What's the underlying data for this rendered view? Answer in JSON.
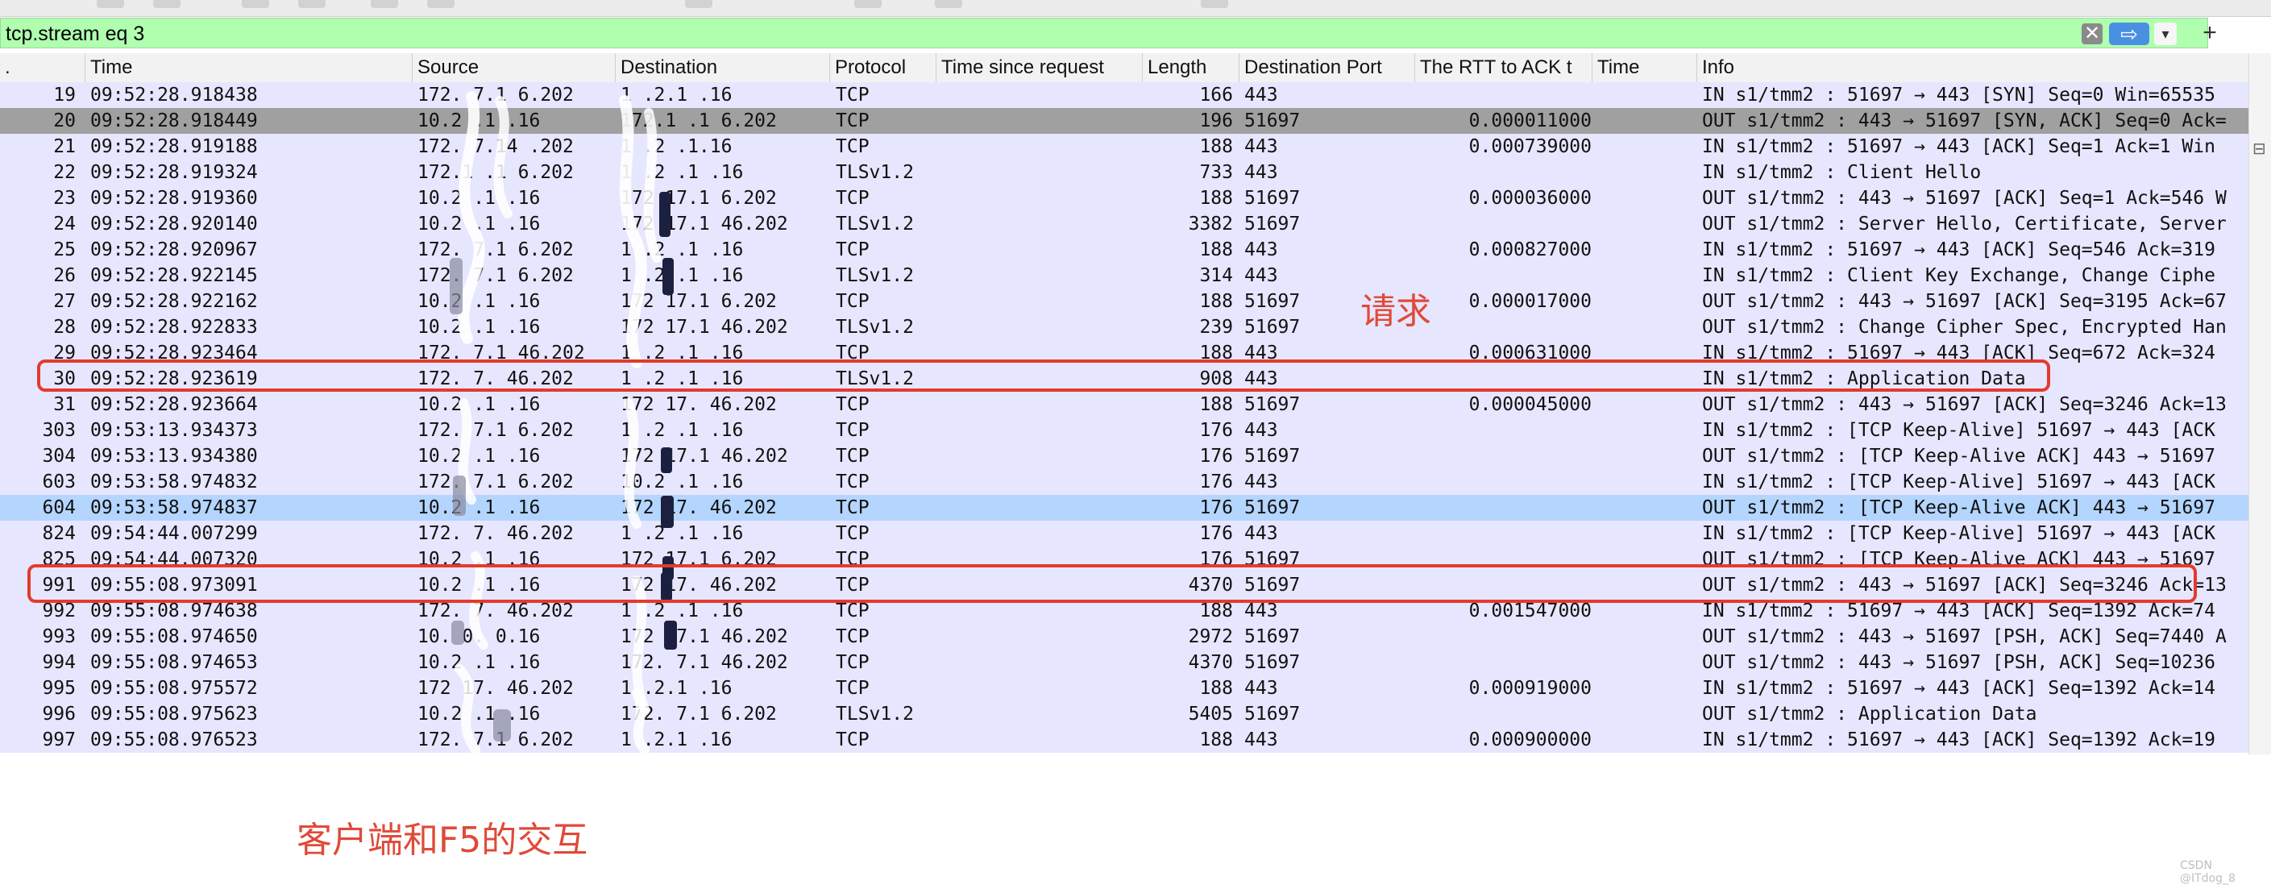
{
  "filter": {
    "expression": "tcp.stream eq 3",
    "clear_icon": "close-icon",
    "apply_icon": "arrow-right-icon",
    "dropdown_icon": "chevron-down-icon",
    "add_label": "+"
  },
  "columns": {
    "no": ".",
    "time": "Time",
    "source": "Source",
    "destination": "Destination",
    "protocol": "Protocol",
    "time_since_request": "Time since request",
    "length": "Length",
    "dest_port": "Destination Port",
    "rtt": "The RTT to ACK t",
    "time2": "Time",
    "info": "Info"
  },
  "packets": [
    {
      "no": "19",
      "time": "09:52:28.918438",
      "src": "172. 7.1 6.202",
      "dst": "1 .2.1 .16",
      "proto": "TCP",
      "len": "166",
      "dport": "443",
      "rtt": "",
      "info": "IN  s1/tmm2 : 51697 → 443 [SYN] Seq=0 Win=65535",
      "style": "tcp"
    },
    {
      "no": "20",
      "time": "09:52:28.918449",
      "src": "10.2 .1 .16",
      "dst": "172.1 .1 6.202",
      "proto": "TCP",
      "len": "196",
      "dport": "51697",
      "rtt": "0.000011000",
      "info": "OUT s1/tmm2 : 443 → 51697 [SYN, ACK] Seq=0 Ack=",
      "style": "dark"
    },
    {
      "no": "21",
      "time": "09:52:28.919188",
      "src": "172. 7.14 .202",
      "dst": "1 .2 .1.16",
      "proto": "TCP",
      "len": "188",
      "dport": "443",
      "rtt": "0.000739000",
      "info": "IN  s1/tmm2 : 51697 → 443 [ACK] Seq=1 Ack=1 Win",
      "style": "tcp"
    },
    {
      "no": "22",
      "time": "09:52:28.919324",
      "src": "172.1 .1 6.202",
      "dst": "1 .2 .1 .16",
      "proto": "TLSv1.2",
      "len": "733",
      "dport": "443",
      "rtt": "",
      "info": "IN  s1/tmm2 : Client Hello",
      "style": "tcp"
    },
    {
      "no": "23",
      "time": "09:52:28.919360",
      "src": "10.2 .1 .16",
      "dst": "172 17.1 6.202",
      "proto": "TCP",
      "len": "188",
      "dport": "51697",
      "rtt": "0.000036000",
      "info": "OUT s1/tmm2 : 443 → 51697 [ACK] Seq=1 Ack=546 W",
      "style": "tcp"
    },
    {
      "no": "24",
      "time": "09:52:28.920140",
      "src": "10.2 .1 .16",
      "dst": "172 17.1 46.202",
      "proto": "TLSv1.2",
      "len": "3382",
      "dport": "51697",
      "rtt": "",
      "info": "OUT s1/tmm2 : Server Hello, Certificate, Server",
      "style": "tcp"
    },
    {
      "no": "25",
      "time": "09:52:28.920967",
      "src": "172. 7.1 6.202",
      "dst": "1 .2 .1 .16",
      "proto": "TCP",
      "len": "188",
      "dport": "443",
      "rtt": "0.000827000",
      "info": "IN  s1/tmm2 : 51697 → 443 [ACK] Seq=546 Ack=319",
      "style": "tcp"
    },
    {
      "no": "26",
      "time": "09:52:28.922145",
      "src": "172. 7.1 6.202",
      "dst": "1 .2 .1 .16",
      "proto": "TLSv1.2",
      "len": "314",
      "dport": "443",
      "rtt": "",
      "info": "IN  s1/tmm2 : Client Key Exchange, Change Ciphe",
      "style": "tcp"
    },
    {
      "no": "27",
      "time": "09:52:28.922162",
      "src": "10.2 .1 .16",
      "dst": "172 17.1 6.202",
      "proto": "TCP",
      "len": "188",
      "dport": "51697",
      "rtt": "0.000017000",
      "info": "OUT s1/tmm2 : 443 → 51697 [ACK] Seq=3195 Ack=67",
      "style": "tcp"
    },
    {
      "no": "28",
      "time": "09:52:28.922833",
      "src": "10.2 .1 .16",
      "dst": "172 17.1 46.202",
      "proto": "TLSv1.2",
      "len": "239",
      "dport": "51697",
      "rtt": "",
      "info": "OUT s1/tmm2 : Change Cipher Spec, Encrypted Han",
      "style": "tcp"
    },
    {
      "no": "29",
      "time": "09:52:28.923464",
      "src": "172. 7.1 46.202",
      "dst": "1 .2 .1 .16",
      "proto": "TCP",
      "len": "188",
      "dport": "443",
      "rtt": "0.000631000",
      "info": "IN  s1/tmm2 : 51697 → 443 [ACK] Seq=672 Ack=324",
      "style": "tcp"
    },
    {
      "no": "30",
      "time": "09:52:28.923619",
      "src": "172. 7. 46.202",
      "dst": "1 .2 .1 .16",
      "proto": "TLSv1.2",
      "len": "908",
      "dport": "443",
      "rtt": "",
      "info": "IN  s1/tmm2 : Application Data",
      "style": "tcp"
    },
    {
      "no": "31",
      "time": "09:52:28.923664",
      "src": "10.2 .1 .16",
      "dst": "172 17. 46.202",
      "proto": "TCP",
      "len": "188",
      "dport": "51697",
      "rtt": "0.000045000",
      "info": "OUT s1/tmm2 : 443 → 51697 [ACK] Seq=3246 Ack=13",
      "style": "tcp"
    },
    {
      "no": "303",
      "time": "09:53:13.934373",
      "src": "172. 7.1 6.202",
      "dst": "1 .2 .1 .16",
      "proto": "TCP",
      "len": "176",
      "dport": "443",
      "rtt": "",
      "info": "IN  s1/tmm2 : [TCP Keep-Alive] 51697 → 443 [ACK",
      "style": "tcp"
    },
    {
      "no": "304",
      "time": "09:53:13.934380",
      "src": "10.2 .1 .16",
      "dst": "172 17.1 46.202",
      "proto": "TCP",
      "len": "176",
      "dport": "51697",
      "rtt": "",
      "info": "OUT s1/tmm2 : [TCP Keep-Alive ACK] 443 → 51697",
      "style": "tcp"
    },
    {
      "no": "603",
      "time": "09:53:58.974832",
      "src": "172. 7.1 6.202",
      "dst": "10.2 .1 .16",
      "proto": "TCP",
      "len": "176",
      "dport": "443",
      "rtt": "",
      "info": "IN  s1/tmm2 : [TCP Keep-Alive] 51697 → 443 [ACK",
      "style": "tcp"
    },
    {
      "no": "604",
      "time": "09:53:58.974837",
      "src": "10.2 .1 .16",
      "dst": "172 17. 46.202",
      "proto": "TCP",
      "len": "176",
      "dport": "51697",
      "rtt": "",
      "info": "OUT s1/tmm2 : [TCP Keep-Alive ACK] 443 → 51697",
      "style": "sel"
    },
    {
      "no": "824",
      "time": "09:54:44.007299",
      "src": "172. 7. 46.202",
      "dst": "1 .2 .1 .16",
      "proto": "TCP",
      "len": "176",
      "dport": "443",
      "rtt": "",
      "info": "IN  s1/tmm2 : [TCP Keep-Alive] 51697 → 443 [ACK",
      "style": "tcp"
    },
    {
      "no": "825",
      "time": "09:54:44.007320",
      "src": "10.2 .1 .16",
      "dst": "172 17.1 6.202",
      "proto": "TCP",
      "len": "176",
      "dport": "51697",
      "rtt": "",
      "info": "OUT s1/tmm2 : [TCP Keep-Alive ACK] 443 → 51697",
      "style": "tcp"
    },
    {
      "no": "991",
      "time": "09:55:08.973091",
      "src": "10.2 .1 .16",
      "dst": "172 17. 46.202",
      "proto": "TCP",
      "len": "4370",
      "dport": "51697",
      "rtt": "",
      "info": "OUT s1/tmm2 : 443 → 51697 [ACK] Seq=3246 Ack=13",
      "style": "tcp"
    },
    {
      "no": "992",
      "time": "09:55:08.974638",
      "src": "172. 7. 46.202",
      "dst": "1 .2 .1 .16",
      "proto": "TCP",
      "len": "188",
      "dport": "443",
      "rtt": "0.001547000",
      "info": "IN  s1/tmm2 : 51697 → 443 [ACK] Seq=1392 Ack=74",
      "style": "tcp"
    },
    {
      "no": "993",
      "time": "09:55:08.974650",
      "src": "10. 0. 0.16",
      "dst": "172 17.1 46.202",
      "proto": "TCP",
      "len": "2972",
      "dport": "51697",
      "rtt": "",
      "info": "OUT s1/tmm2 : 443 → 51697 [PSH, ACK] Seq=7440 A",
      "style": "tcp"
    },
    {
      "no": "994",
      "time": "09:55:08.974653",
      "src": "10.2 .1 .16",
      "dst": "172. 7.1 46.202",
      "proto": "TCP",
      "len": "4370",
      "dport": "51697",
      "rtt": "",
      "info": "OUT s1/tmm2 : 443 → 51697 [PSH, ACK] Seq=10236",
      "style": "tcp"
    },
    {
      "no": "995",
      "time": "09:55:08.975572",
      "src": "172 17. 46.202",
      "dst": "1 .2.1 .16",
      "proto": "TCP",
      "len": "188",
      "dport": "443",
      "rtt": "0.000919000",
      "info": "IN  s1/tmm2 : 51697 → 443 [ACK] Seq=1392 Ack=14",
      "style": "tcp"
    },
    {
      "no": "996",
      "time": "09:55:08.975623",
      "src": "10.2 .1 .16",
      "dst": "172. 7.1 6.202",
      "proto": "TLSv1.2",
      "len": "5405",
      "dport": "51697",
      "rtt": "",
      "info": "OUT s1/tmm2 : Application Data",
      "style": "tcp"
    },
    {
      "no": "997",
      "time": "09:55:08.976523",
      "src": "172. 7.1 6.202",
      "dst": "1 .2.1 .16",
      "proto": "TCP",
      "len": "188",
      "dport": "443",
      "rtt": "0.000900000",
      "info": "IN  s1/tmm2 : 51697 → 443 [ACK] Seq=1392 Ack=19",
      "style": "tcp"
    }
  ],
  "annotations": {
    "request_label": "请求",
    "client_f5_label": "客户端和F5的交互",
    "color": "#e23b2e"
  },
  "watermark": "CSDN @ITdog_8"
}
